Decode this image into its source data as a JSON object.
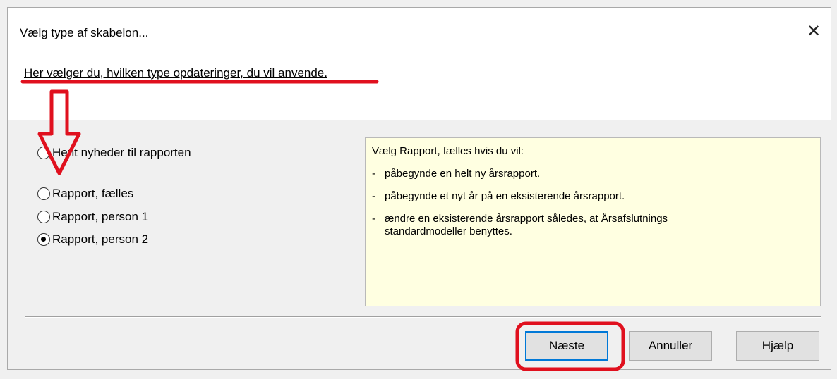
{
  "dialog": {
    "title": "Vælg type af skabelon...",
    "close_symbol": "✕",
    "subtitle": "Her vælger du, hvilken type opdateringer, du vil anvende."
  },
  "options": [
    {
      "label": "Hent nyheder til rapporten",
      "checked": false
    },
    {
      "label": "Rapport, fælles",
      "checked": false
    },
    {
      "label": "Rapport, person 1",
      "checked": false
    },
    {
      "label": "Rapport, person 2",
      "checked": true
    }
  ],
  "info": {
    "heading": "Vælg Rapport, fælles hvis du vil:",
    "bullets": [
      {
        "dash": "-",
        "text": "påbegynde en helt ny årsrapport."
      },
      {
        "dash": "-",
        "text": "påbegynde et nyt år på en eksisterende årsrapport."
      },
      {
        "dash": "-",
        "text": "ændre en eksisterende årsrapport således, at Årsafslutnings standardmodeller benyttes."
      }
    ]
  },
  "buttons": {
    "next": "Næste",
    "cancel": "Annuller",
    "help": "Hjælp"
  },
  "annotations": {
    "color": "#e0101e",
    "underline_under": "subtitle",
    "arrow_points_to": "options",
    "circle_around": "next-button"
  }
}
